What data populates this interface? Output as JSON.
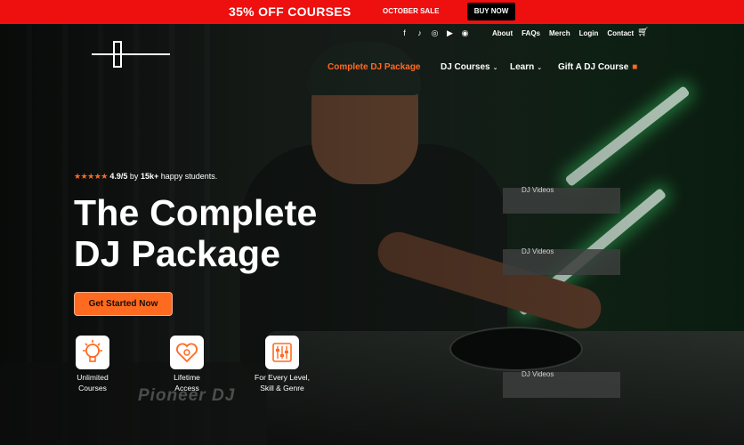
{
  "promo": {
    "title": "35% OFF COURSES",
    "sale": "OCTOBER SALE",
    "button": "BUY NOW"
  },
  "social_icons": [
    "facebook-icon",
    "tiktok-icon",
    "instagram-icon",
    "youtube-icon",
    "rss-icon"
  ],
  "utility_nav": [
    "About",
    "FAQs",
    "Merch",
    "Login",
    "Contact"
  ],
  "main_nav": {
    "package": "Complete DJ Package",
    "courses": "DJ Courses",
    "learn": "Learn",
    "gift": "Gift A DJ Course"
  },
  "rating": {
    "stars": "★★★★★",
    "score": "4.9/5",
    "by": "by",
    "count": "15k+",
    "suffix": "happy students."
  },
  "hero": {
    "title_line1": "The Complete",
    "title_line2": "DJ Package",
    "cta": "Get Started Now"
  },
  "features": [
    {
      "icon": "lightbulb-gear-icon",
      "line1": "Unlimited",
      "line2": "Courses"
    },
    {
      "icon": "heart-shield-icon",
      "line1": "Lifetime",
      "line2": "Access"
    },
    {
      "icon": "sliders-icon",
      "line1": "For Every Level,",
      "line2": "Skill & Genre"
    }
  ],
  "video_cards": [
    "DJ Videos",
    "DJ Videos",
    "DJ Videos"
  ],
  "brand_text": "Pioneer DJ",
  "colors": {
    "promo_red": "#ee0f0f",
    "accent_orange": "#ff6a21",
    "glow_green": "#3cdc6e"
  }
}
